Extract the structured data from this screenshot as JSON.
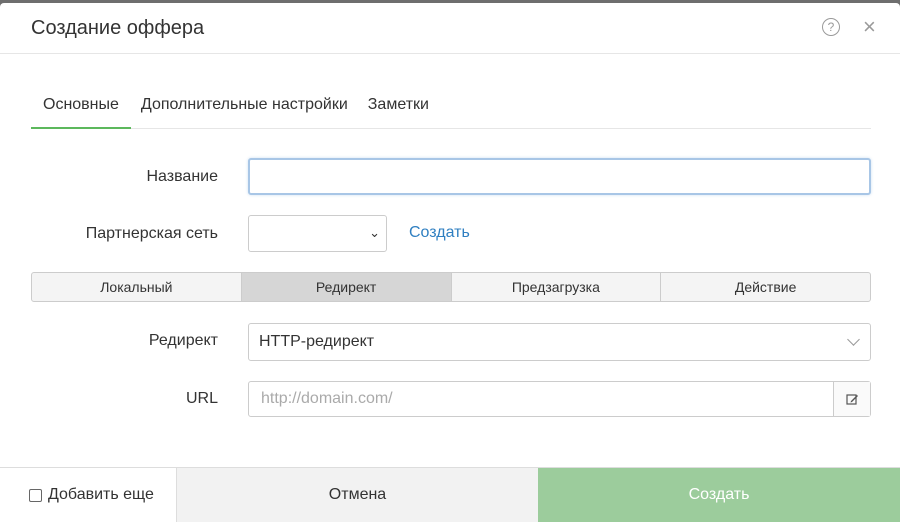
{
  "dialog": {
    "title": "Создание оффера",
    "help_icon": "question-circle-icon",
    "close_icon": "close-icon"
  },
  "tabs": [
    {
      "label": "Основные",
      "active": true
    },
    {
      "label": "Дополнительные настройки",
      "active": false
    },
    {
      "label": "Заметки",
      "active": false
    }
  ],
  "fields": {
    "name": {
      "label": "Название",
      "value": ""
    },
    "network": {
      "label": "Партнерская сеть",
      "value": "",
      "create_link": "Создать"
    },
    "redirect": {
      "label": "Редирект",
      "value": "HTTP-редирект"
    },
    "url": {
      "label": "URL",
      "placeholder": "http://domain.com/",
      "button_icon": "edit-icon"
    }
  },
  "modes": [
    {
      "label": "Локальный",
      "active": false
    },
    {
      "label": "Редирект",
      "active": true
    },
    {
      "label": "Предзагрузка",
      "active": false
    },
    {
      "label": "Действие",
      "active": false
    }
  ],
  "footer": {
    "add_more_label": "Добавить еще",
    "add_more_checked": false,
    "cancel_label": "Отмена",
    "create_label": "Создать"
  },
  "colors": {
    "active_tab_underline": "#5cb85c",
    "link": "#2f7fc1",
    "create_button": "#9ccc9c"
  }
}
